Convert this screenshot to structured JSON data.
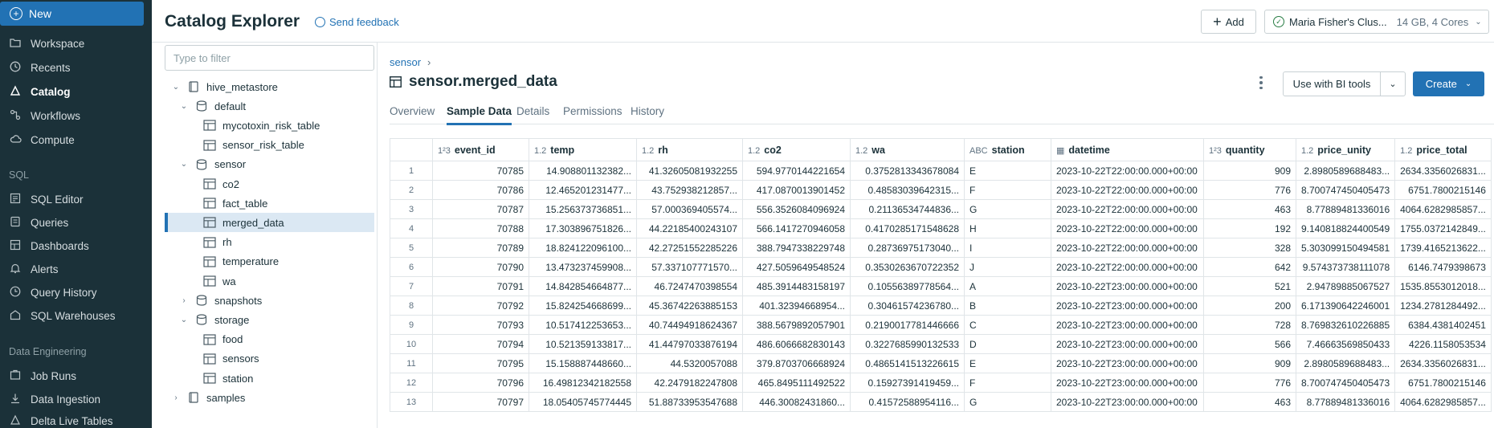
{
  "nav": {
    "new_label": "New",
    "items": [
      {
        "label": "Workspace",
        "icon": "folder-icon"
      },
      {
        "label": "Recents",
        "icon": "clock-icon"
      },
      {
        "label": "Catalog",
        "icon": "catalog-icon"
      },
      {
        "label": "Workflows",
        "icon": "workflows-icon"
      },
      {
        "label": "Compute",
        "icon": "cloud-icon"
      }
    ],
    "sql_section": "SQL",
    "sql_items": [
      {
        "label": "SQL Editor",
        "icon": "editor-icon"
      },
      {
        "label": "Queries",
        "icon": "queries-icon"
      },
      {
        "label": "Dashboards",
        "icon": "dashboards-icon"
      },
      {
        "label": "Alerts",
        "icon": "alert-icon"
      },
      {
        "label": "Query History",
        "icon": "history-icon"
      },
      {
        "label": "SQL Warehouses",
        "icon": "warehouse-icon"
      }
    ],
    "de_section": "Data Engineering",
    "de_items": [
      {
        "label": "Job Runs",
        "icon": "job-runs-icon"
      },
      {
        "label": "Data Ingestion",
        "icon": "ingestion-icon"
      },
      {
        "label": "Delta Live Tables",
        "icon": "dlt-icon"
      }
    ]
  },
  "header": {
    "title": "Catalog Explorer",
    "feedback": "Send feedback",
    "add_label": "Add",
    "cluster_name": "Maria Fisher's Clus...",
    "cluster_meta": "14 GB, 4 Cores"
  },
  "tree": {
    "filter_placeholder": "Type to filter",
    "nodes": [
      {
        "label": "hive_metastore",
        "kind": "catalog",
        "expanded": true
      },
      {
        "label": "default",
        "kind": "schema",
        "expanded": true
      },
      {
        "label": "mycotoxin_risk_table",
        "kind": "table"
      },
      {
        "label": "sensor_risk_table",
        "kind": "table"
      },
      {
        "label": "sensor",
        "kind": "schema",
        "expanded": true
      },
      {
        "label": "co2",
        "kind": "table"
      },
      {
        "label": "fact_table",
        "kind": "table"
      },
      {
        "label": "merged_data",
        "kind": "table",
        "selected": true
      },
      {
        "label": "rh",
        "kind": "table"
      },
      {
        "label": "temperature",
        "kind": "table"
      },
      {
        "label": "wa",
        "kind": "table"
      },
      {
        "label": "snapshots",
        "kind": "schema",
        "expanded": false
      },
      {
        "label": "storage",
        "kind": "schema",
        "expanded": true
      },
      {
        "label": "food",
        "kind": "table"
      },
      {
        "label": "sensors",
        "kind": "table"
      },
      {
        "label": "station",
        "kind": "table"
      },
      {
        "label": "samples",
        "kind": "catalog",
        "expanded": false
      }
    ]
  },
  "main": {
    "breadcrumb": "sensor",
    "table_title": "sensor.merged_data",
    "bi_label": "Use with BI tools",
    "create_label": "Create",
    "tabs": [
      "Overview",
      "Sample Data",
      "Details",
      "Permissions",
      "History"
    ],
    "active_tab": "Sample Data"
  },
  "grid": {
    "columns": [
      {
        "name": "event_id",
        "type": "1²3"
      },
      {
        "name": "temp",
        "type": "1.2"
      },
      {
        "name": "rh",
        "type": "1.2"
      },
      {
        "name": "co2",
        "type": "1.2"
      },
      {
        "name": "wa",
        "type": "1.2"
      },
      {
        "name": "station",
        "type": "ABC"
      },
      {
        "name": "datetime",
        "type": "cal"
      },
      {
        "name": "quantity",
        "type": "1²3"
      },
      {
        "name": "price_unity",
        "type": "1.2"
      },
      {
        "name": "price_total",
        "type": "1.2"
      }
    ],
    "rows": [
      [
        "1",
        "70785",
        "14.908801132382...",
        "41.32605081932255",
        "594.9770144221654",
        "0.3752813343678084",
        "E",
        "2023-10-22T22:00:00.000+00:00",
        "909",
        "2.8980589688483...",
        "2634.3356026831..."
      ],
      [
        "2",
        "70786",
        "12.465201231477...",
        "43.752938212857...",
        "417.0870013901452",
        "0.48583039642315...",
        "F",
        "2023-10-22T22:00:00.000+00:00",
        "776",
        "8.700747450405473",
        "6751.7800215146"
      ],
      [
        "3",
        "70787",
        "15.256373736851...",
        "57.000369405574...",
        "556.3526084096924",
        "0.21136534744836...",
        "G",
        "2023-10-22T22:00:00.000+00:00",
        "463",
        "8.77889481336016",
        "4064.6282985857..."
      ],
      [
        "4",
        "70788",
        "17.303896751826...",
        "44.22185400243107",
        "566.1417270946058",
        "0.4170285171548628",
        "H",
        "2023-10-22T22:00:00.000+00:00",
        "192",
        "9.140818824400549",
        "1755.0372142849..."
      ],
      [
        "5",
        "70789",
        "18.824122096100...",
        "42.27251552285226",
        "388.7947338229748",
        "0.28736975173040...",
        "I",
        "2023-10-22T22:00:00.000+00:00",
        "328",
        "5.303099150494581",
        "1739.4165213622..."
      ],
      [
        "6",
        "70790",
        "13.473237459908...",
        "57.337107771570...",
        "427.5059649548524",
        "0.3530263670722352",
        "J",
        "2023-10-22T22:00:00.000+00:00",
        "642",
        "9.574373738111078",
        "6146.7479398673"
      ],
      [
        "7",
        "70791",
        "14.842854664877...",
        "46.7247470398554",
        "485.3914483158197",
        "0.10556389778564...",
        "A",
        "2023-10-22T23:00:00.000+00:00",
        "521",
        "2.94789885067527",
        "1535.8553012018..."
      ],
      [
        "8",
        "70792",
        "15.824254668699...",
        "45.36742263885153",
        "401.32394668954...",
        "0.30461574236780...",
        "B",
        "2023-10-22T23:00:00.000+00:00",
        "200",
        "6.171390642246001",
        "1234.2781284492..."
      ],
      [
        "9",
        "70793",
        "10.517412253653...",
        "40.74494918624367",
        "388.5679892057901",
        "0.2190017781446666",
        "C",
        "2023-10-22T23:00:00.000+00:00",
        "728",
        "8.769832610226885",
        "6384.4381402451"
      ],
      [
        "10",
        "70794",
        "10.521359133817...",
        "41.44797033876194",
        "486.6066682830143",
        "0.3227685990132533",
        "D",
        "2023-10-22T23:00:00.000+00:00",
        "566",
        "7.46663569850433",
        "4226.1158053534"
      ],
      [
        "11",
        "70795",
        "15.158887448660...",
        "44.5320057088",
        "379.8703706668924",
        "0.4865141513226615",
        "E",
        "2023-10-22T23:00:00.000+00:00",
        "909",
        "2.8980589688483...",
        "2634.3356026831..."
      ],
      [
        "12",
        "70796",
        "16.49812342182558",
        "42.2479182247808",
        "465.8495111492522",
        "0.15927391419459...",
        "F",
        "2023-10-22T23:00:00.000+00:00",
        "776",
        "8.700747450405473",
        "6751.7800215146"
      ],
      [
        "13",
        "70797",
        "18.05405745774445",
        "51.88733953547688",
        "446.30082431860...",
        "0.41572588954116...",
        "G",
        "2023-10-22T23:00:00.000+00:00",
        "463",
        "8.77889481336016",
        "4064.6282985857..."
      ]
    ]
  }
}
